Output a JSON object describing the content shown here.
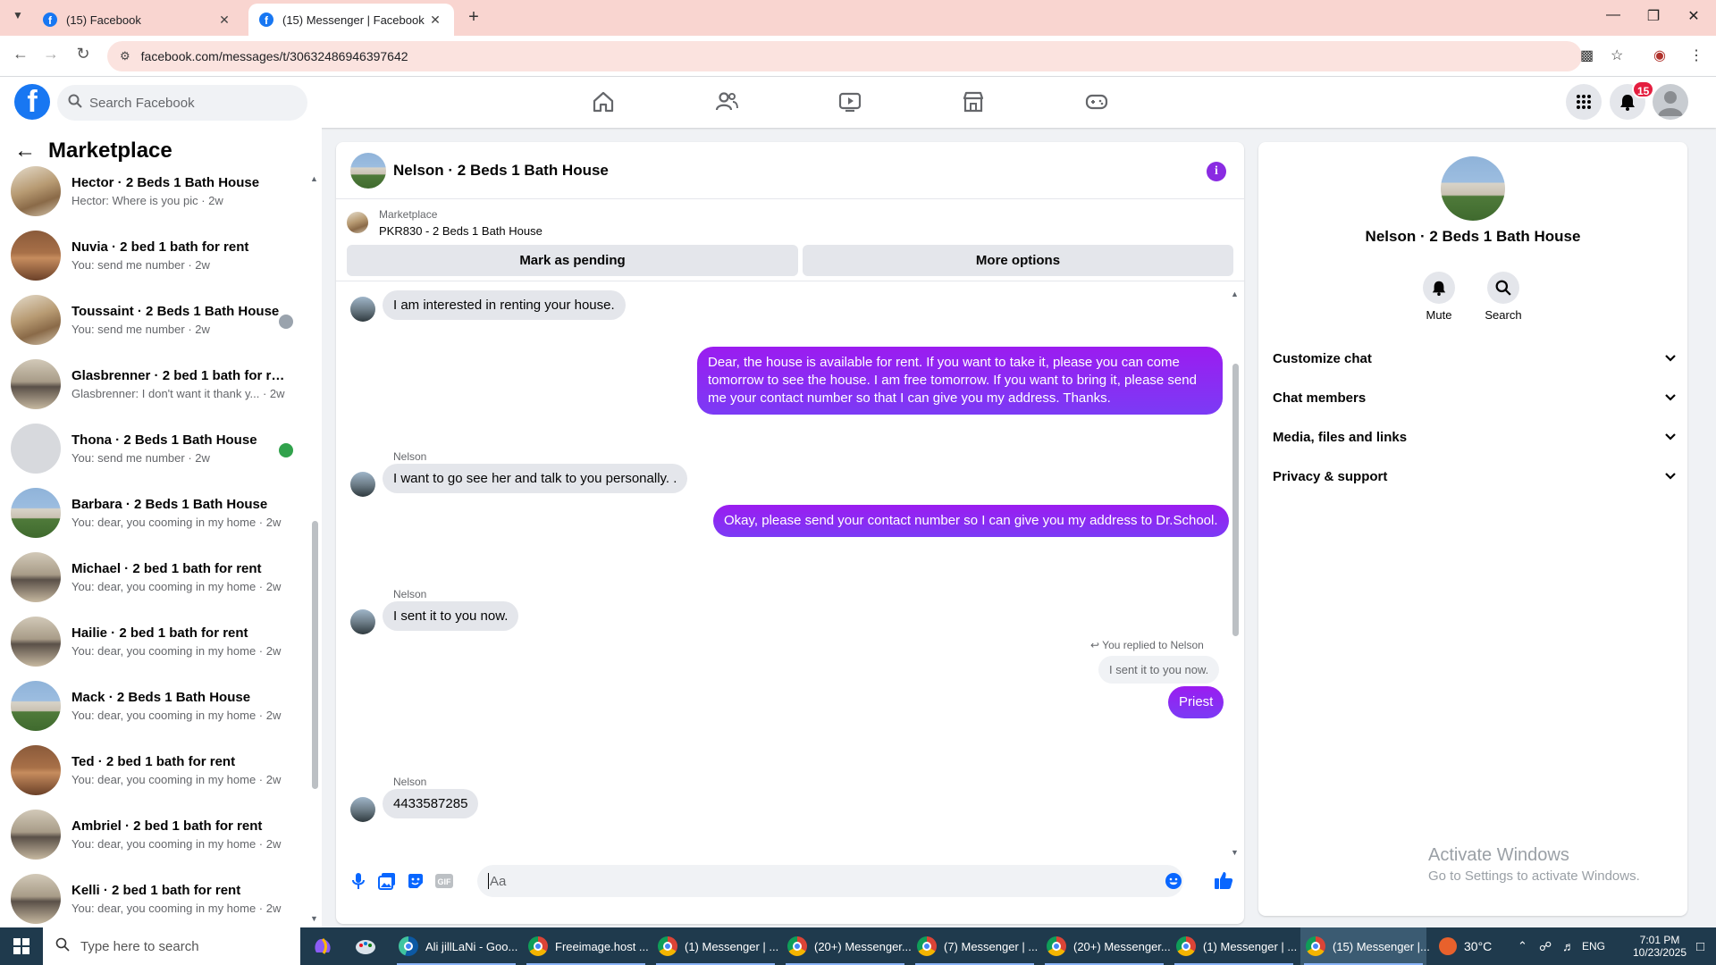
{
  "browser": {
    "tabs": [
      {
        "title": "(15) Facebook"
      },
      {
        "title": "(15) Messenger | Facebook"
      }
    ],
    "url": "facebook.com/messages/t/30632486946397642"
  },
  "fb": {
    "search_placeholder": "Search Facebook",
    "notification_count": "15"
  },
  "sidebar": {
    "title": "Marketplace",
    "conversations": [
      {
        "name": "Hector · 2 Beds 1 Bath House",
        "preview": "Hector: Where is you pic · 2w",
        "thumb": "room2"
      },
      {
        "name": "Nuvia · 2 bed 1 bath for rent",
        "preview": "You: send me number · 2w",
        "thumb": "room"
      },
      {
        "name": "Toussaint · 2 Beds 1 Bath House",
        "preview": "You: send me number · 2w",
        "thumb": "room2"
      },
      {
        "name": "Glasbrenner · 2 bed 1 bath for re...",
        "preview": "Glasbrenner: I don't want it thank y... · 2w",
        "thumb": "room3"
      },
      {
        "name": "Thona · 2 Beds 1 Bath House",
        "preview": "You: send me number · 2w",
        "thumb": "grey"
      },
      {
        "name": "Barbara · 2 Beds 1 Bath House",
        "preview": "You: dear, you cooming in my home · 2w",
        "thumb": "house"
      },
      {
        "name": "Michael · 2 bed 1 bath for rent",
        "preview": "You: dear, you cooming in my home · 2w",
        "thumb": "room3"
      },
      {
        "name": "Hailie · 2 bed 1 bath for rent",
        "preview": "You: dear, you cooming in my home · 2w",
        "thumb": "room3"
      },
      {
        "name": "Mack · 2 Beds 1 Bath House",
        "preview": "You: dear, you cooming in my home · 2w",
        "thumb": "house"
      },
      {
        "name": "Ted · 2 bed 1 bath for rent",
        "preview": "You: dear, you cooming in my home · 2w",
        "thumb": "room"
      },
      {
        "name": "Ambriel · 2 bed 1 bath for rent",
        "preview": "You: dear, you cooming in my home · 2w",
        "thumb": "room3"
      },
      {
        "name": "Kelli · 2 bed 1 bath for rent",
        "preview": "You: dear, you cooming in my home · 2w",
        "thumb": "room3"
      }
    ]
  },
  "chat": {
    "title": "Nelson · 2 Beds 1 Bath House",
    "marketplace_label": "Marketplace",
    "listing": "PKR830 - 2 Beds 1 Bath House",
    "mark_pending": "Mark as pending",
    "more_options": "More options",
    "messages": {
      "m1": "I am interested in renting your house.",
      "m2": "Dear, the house is available for rent. If you want to take it, please you can come tomorrow to see the house. I am free tomorrow. If you want to bring it, please send me your contact number so that I can give you my address. Thanks.",
      "sender": "Nelson",
      "m3": "I want to go see her and talk to you personally. .",
      "m4": "Okay, please send your contact number so I can give you my address to Dr.School.",
      "m5": "I sent it to you now.",
      "reply_note": "You replied to Nelson",
      "reply_quote": "I sent it to you now.",
      "m6": "Priest",
      "m7": "4433587285"
    },
    "composer_placeholder": "Aa"
  },
  "info_panel": {
    "name": "Nelson · 2 Beds 1 Bath House",
    "mute": "Mute",
    "search": "Search",
    "rows": [
      "Customize chat",
      "Chat members",
      "Media, files and links",
      "Privacy & support"
    ]
  },
  "watermark": {
    "line1": "Activate Windows",
    "line2": "Go to Settings to activate Windows."
  },
  "taskbar": {
    "search_placeholder": "Type here to search",
    "items": [
      "Ali jillLaNi - Goo...",
      "Freeimage.host ...",
      "(1) Messenger | ...",
      "(20+) Messenger...",
      "(7) Messenger | ...",
      "(20+) Messenger...",
      "(1) Messenger | ...",
      "(15) Messenger |..."
    ],
    "temperature": "30°C",
    "language": "ENG",
    "time": "7:01 PM",
    "date": "10/23/2025"
  }
}
